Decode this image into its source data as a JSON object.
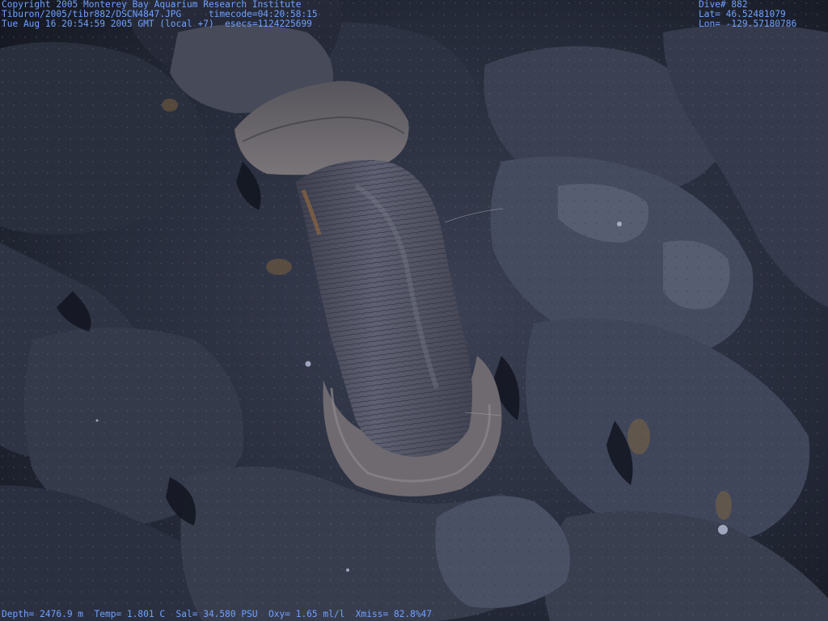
{
  "header_left": {
    "line1": "Copyright 2005 Monterey Bay Aquarium Research Institute",
    "line2": "Tiburon/2005/tibr882/DSCN4847.JPG     timecode=04:20:58:15",
    "line3": "Tue Aug 16 20:54:59 2005 GMT (local +7)  esecs=1124225699"
  },
  "header_right": {
    "dive": "Dive# 882",
    "lat": "Lat= 46.52481079",
    "lon": "Lon= -129.57180786"
  },
  "footer": {
    "telemetry": "Depth= 2476.9 m  Temp= 1.801 C  Sal= 34.580 PSU  Oxy= 1.65 ml/l  Xmiss= 82.8%47"
  },
  "colors": {
    "overlay_text": "#6fa0ff",
    "water": "#1c2130",
    "rock": "#3d4356",
    "rock_light": "#5a6175",
    "worm_body": "#58596a",
    "tube_rim": "#6f6c72"
  }
}
